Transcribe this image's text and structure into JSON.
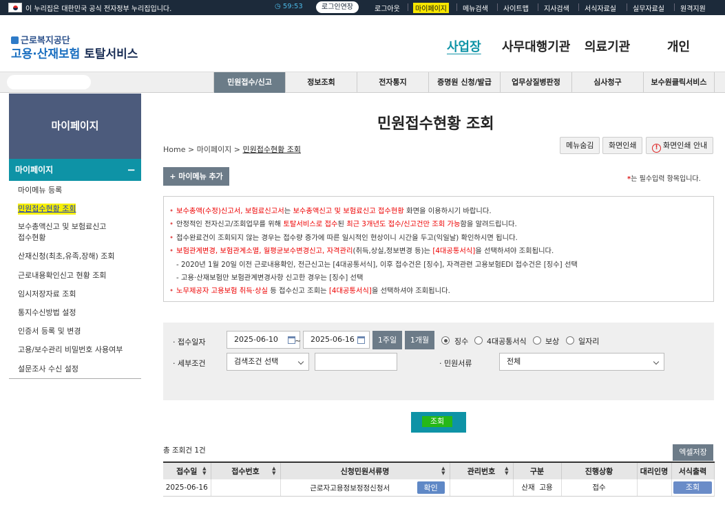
{
  "gov_banner": {
    "text": "이 누리집은 대한민국 공식 전자정부 누리집입니다.",
    "session_time": "59:53",
    "extend_label": "로그인연장",
    "links": [
      "로그아웃",
      "마이페이지",
      "메뉴검색",
      "사이트맵",
      "지사검색",
      "서식자료실",
      "실무자료실",
      "원격지원"
    ]
  },
  "header": {
    "org_name": "근로복지공단",
    "service_name_a": "고용·산재보험",
    "service_name_b": "토탈서비스",
    "top_nav": [
      "사업장",
      "사무대행기관",
      "의료기관",
      "개인"
    ],
    "active_top_nav": "사업장"
  },
  "gnb": [
    "민원접수/신고",
    "정보조회",
    "전자통지",
    "증명원 신청/발급",
    "업무상질병판정",
    "심사청구",
    "보수원클릭서비스"
  ],
  "sidebar": {
    "title": "마이페이지",
    "section": "마이페이지",
    "items": [
      "마이메뉴 등록",
      "민원접수현황 조회",
      "보수총액신고 및 보험료신고",
      "접수현황",
      "산재신청(최초,유족,장해) 조회",
      "근로내용확인신고 현황 조회",
      "임시저장자료 조회",
      "통지수신방법 설정",
      "인증서 등록 및 변경",
      "고용/보수관리 비밀번호 사용여부",
      "설문조사 수신 설정"
    ]
  },
  "page": {
    "title": "민원접수현황 조회",
    "breadcrumb": [
      "Home",
      "마이페이지",
      "민원접수현황 조회"
    ],
    "buttons": {
      "hide_menu": "메뉴숨김",
      "print": "화면인쇄",
      "print_help": "화면인쇄 안내"
    },
    "add_menu": "+ 마이메뉴 추가",
    "required_note_star": "*",
    "required_note": "는 필수입력 항목입니다."
  },
  "notice": {
    "l1": {
      "a": "보수총액(수정)신고서, 보험료신고서",
      "b": "는 ",
      "c": "보수총액신고 및 보험료신고 접수현황",
      "d": " 화면을 이용하시기 바랍니다."
    },
    "l2": {
      "a": "안정적인 전자신고/조회업무를 위해 ",
      "b": "토탈서비스로 접수",
      "c": "된 ",
      "d": "최근 3개년도 접수/신고건만 조회 가능",
      "e": "함을 알려드립니다."
    },
    "l3": "접수완료건이 조회되지 않는 경우는 접수량 증가에 따른 일시적인 현상이니 시간을 두고(익일날) 확인하시면 됩니다.",
    "l4": {
      "a": "보험관계변경, 보험관계소멸, 월평균보수변경신고, 자격관리",
      "b": "(취득,상실,정보변경 등)는 ",
      "c": "[4대공통서식]",
      "d": "을 선택하셔야 조회됩니다."
    },
    "l5": "- 2020년 1월 20일 이전 근로내용확인, 전근신고는 [4대공통서식], 이후 접수건은 [징수], 자격관련 고용보험EDI 접수건은 [징수] 선택",
    "l6": "- 고용·산재보험만 보험관계변경사항 신고한 경우는 [징수] 선택",
    "l7": {
      "a": "노무제공자 고용보험 취득·상실",
      "b": " 등 접수신고 조회는 ",
      "c": "[4대공통서식]",
      "d": "을 선택하셔야 조회됩니다."
    }
  },
  "search": {
    "date_label": "· 접수일자",
    "date_from": "2025-06-10",
    "tilde": "~",
    "date_to": "2025-06-16",
    "week_btn": "1주일",
    "month_btn": "1개월",
    "radios": [
      "징수",
      "4대공통서식",
      "보상",
      "일자리"
    ],
    "radio_selected": 0,
    "detail_label": "· 세부조건",
    "detail_select": "검색조건 선택",
    "detail_input": "",
    "type_label": "· 민원서류",
    "type_select": "전체",
    "submit": "조회"
  },
  "results": {
    "total": "총 조회건 1건",
    "excel": "엑셀저장",
    "columns": [
      "접수일",
      "접수번호",
      "신청민원서류명",
      "관리번호",
      "구분",
      "진행상황",
      "대리인명",
      "서식출력"
    ],
    "rows": [
      {
        "date": "2025-06-16",
        "number": "",
        "doc": "근로자고용정보정정신청서",
        "confirm": "확인",
        "mgmt": "",
        "type_a": "산재",
        "type_b": "고용",
        "status": "접수",
        "agent": "",
        "print": "조회"
      }
    ]
  },
  "colors": {
    "accent": "#0e93a6",
    "gnb_active": "#6b7c88",
    "sidebar_head": "#4c5b7c",
    "highlight": "#f7f000",
    "alert": "#e00000"
  }
}
